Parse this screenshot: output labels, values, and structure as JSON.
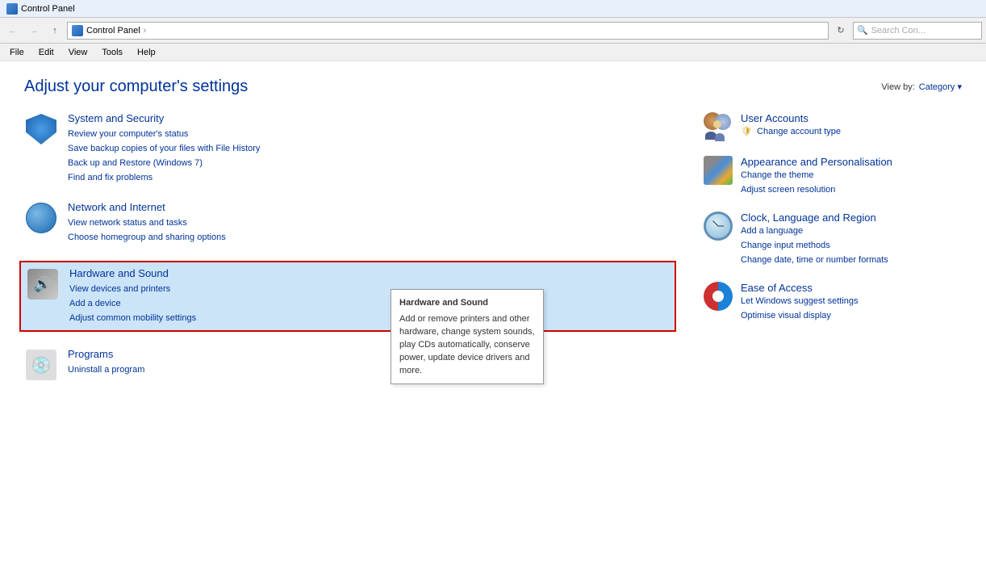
{
  "titlebar": {
    "icon": "control-panel-icon",
    "title": "Control Panel"
  },
  "addressbar": {
    "back_tooltip": "Back",
    "forward_tooltip": "Forward",
    "up_tooltip": "Up",
    "breadcrumb_icon": "folder-icon",
    "path": "Control Panel",
    "path_separator": "›",
    "refresh_tooltip": "Refresh",
    "search_placeholder": "Search Con..."
  },
  "menubar": {
    "items": [
      "File",
      "Edit",
      "View",
      "Tools",
      "Help"
    ]
  },
  "page": {
    "title": "Adjust your computer's settings",
    "view_by_label": "View by:",
    "view_by_value": "Category"
  },
  "categories": [
    {
      "id": "system-security",
      "title": "System and Security",
      "links": [
        "Review your computer's status",
        "Save backup copies of your files with File History",
        "Back up and Restore (Windows 7)",
        "Find and fix problems"
      ]
    },
    {
      "id": "network-internet",
      "title": "Network and Internet",
      "links": [
        "View network status and tasks",
        "Choose homegroup and sharing options"
      ]
    },
    {
      "id": "hardware-sound",
      "title": "Hardware and Sound",
      "highlighted": true,
      "links": [
        "View devices and printers",
        "Add a device",
        "Adjust common mobility settings"
      ]
    },
    {
      "id": "programs",
      "title": "Programs",
      "links": [
        "Uninstall a program"
      ]
    }
  ],
  "right_categories": [
    {
      "id": "user-accounts",
      "title": "User Accounts",
      "links": [
        "Change account type"
      ]
    },
    {
      "id": "appearance",
      "title": "Appearance and Personalisation",
      "links": [
        "Change the theme",
        "Adjust screen resolution"
      ]
    },
    {
      "id": "clock",
      "title": "Clock, Language and Region",
      "links": [
        "Add a language",
        "Change input methods",
        "Change date, time or number formats"
      ]
    },
    {
      "id": "ease-of-access",
      "title": "Ease of Access",
      "links": [
        "Let Windows suggest settings",
        "Optimise visual display"
      ]
    }
  ],
  "tooltip": {
    "title": "Hardware and Sound",
    "body": "Add or remove printers and other hardware, change system sounds, play CDs automatically, conserve power, update device drivers and more."
  }
}
